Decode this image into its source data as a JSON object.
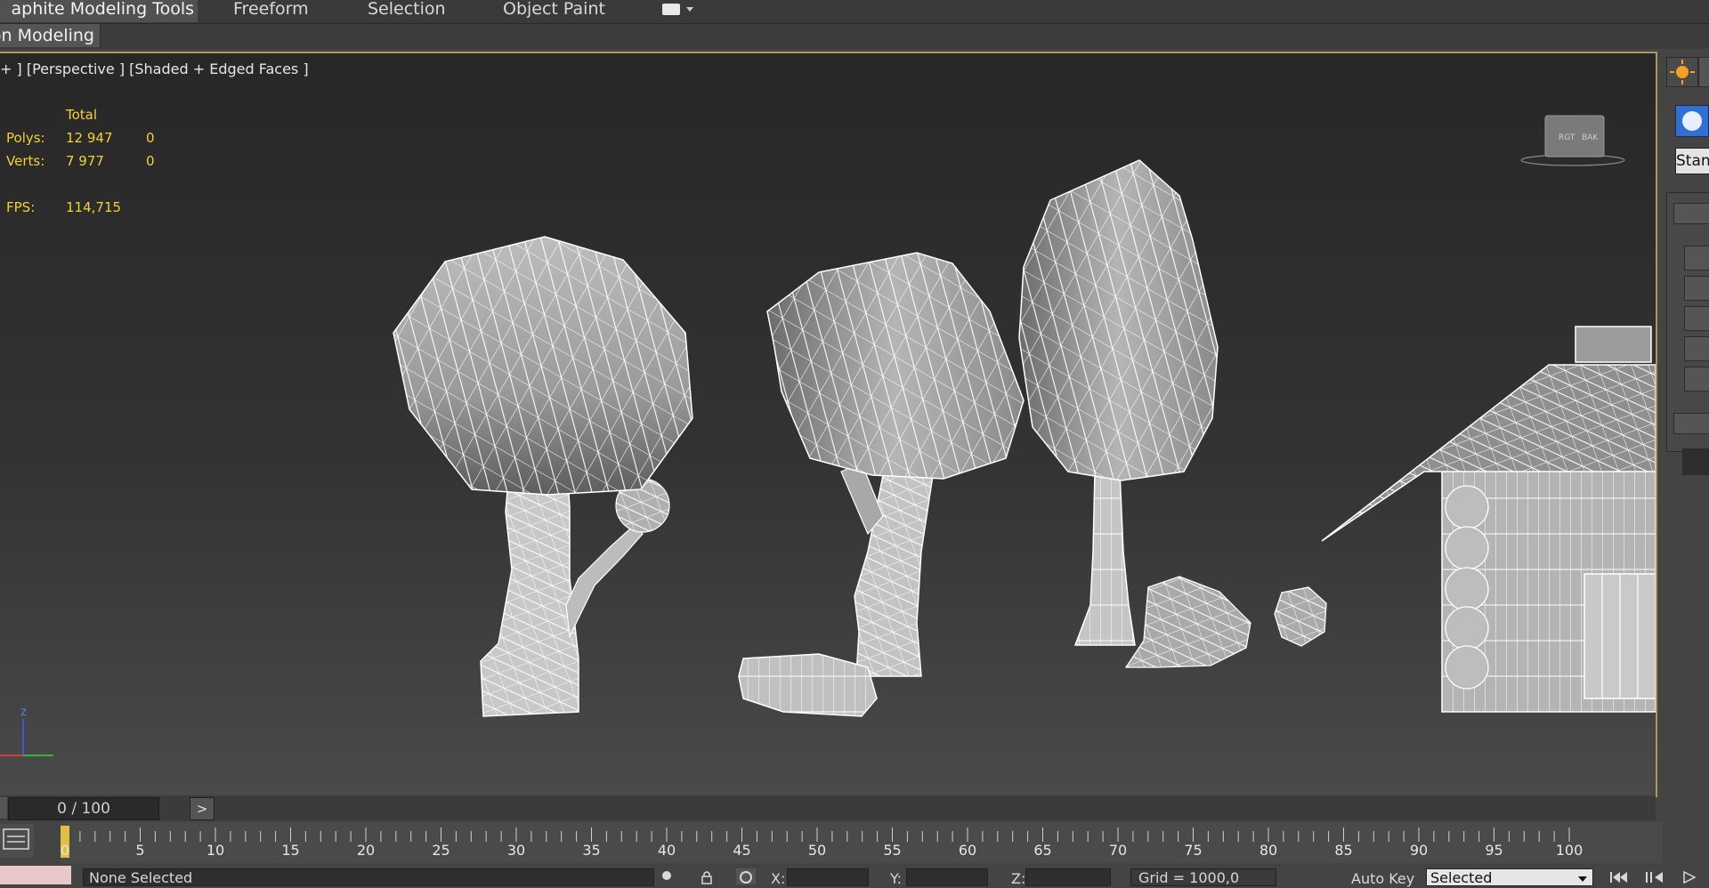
{
  "ribbon": {
    "tabs": [
      {
        "label": "aphite Modeling Tools",
        "active": true
      },
      {
        "label": "Freeform"
      },
      {
        "label": "Selection"
      },
      {
        "label": "Object Paint"
      }
    ],
    "sub_tab": "on Modeling"
  },
  "viewport": {
    "label": "+ ] [Perspective ] [Shaded + Edged Faces ]",
    "stats": {
      "header": "Total",
      "polys_label": "Polys:",
      "polys_total": "12 947",
      "polys_sel": "0",
      "verts_label": "Verts:",
      "verts_total": "7 977",
      "verts_sel": "0",
      "fps_label": "FPS:",
      "fps_value": "114,715"
    },
    "viewcube": {
      "face_left": "RGT",
      "face_right": "BAK"
    },
    "axis": {
      "z": "z"
    },
    "border_color": "#a89a5c"
  },
  "command_panel": {
    "dropdown_text": "Stan"
  },
  "timeline": {
    "frame_display": "0 / 100",
    "next_label": ">",
    "ticks": [
      "0",
      "5",
      "10",
      "15",
      "20",
      "25",
      "30",
      "35",
      "40",
      "45",
      "50",
      "55",
      "60",
      "65",
      "70",
      "75",
      "80",
      "85",
      "90",
      "95",
      "100"
    ]
  },
  "status_bar": {
    "selection": "None Selected",
    "x_label": "X:",
    "y_label": "Y:",
    "z_label": "Z:",
    "grid": "Grid = 1000,0",
    "auto_key": "Auto Key",
    "key_mode": "Selected"
  }
}
